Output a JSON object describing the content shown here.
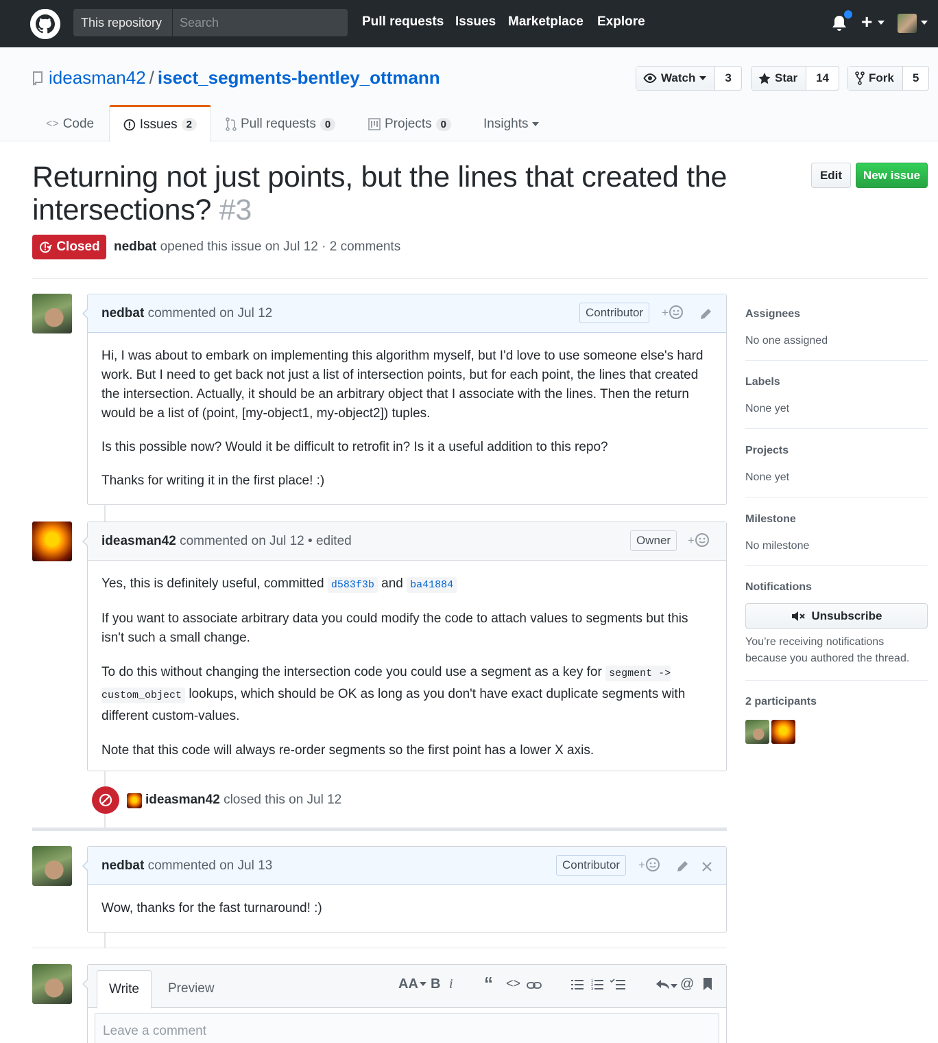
{
  "header": {
    "scope_label": "This repository",
    "search_placeholder": "Search",
    "nav": [
      "Pull requests",
      "Issues",
      "Marketplace",
      "Explore"
    ]
  },
  "repo": {
    "owner": "ideasman42",
    "name": "isect_segments-bentley_ottmann",
    "watch_label": "Watch",
    "watch_count": "3",
    "star_label": "Star",
    "star_count": "14",
    "fork_label": "Fork",
    "fork_count": "5",
    "tabs": [
      {
        "label": "Code",
        "count": ""
      },
      {
        "label": "Issues",
        "count": "2"
      },
      {
        "label": "Pull requests",
        "count": "0"
      },
      {
        "label": "Projects",
        "count": "0"
      },
      {
        "label": "Insights",
        "count": ""
      }
    ]
  },
  "issue": {
    "title": "Returning not just points, but the lines that created the intersections?",
    "number": "#3",
    "edit_label": "Edit",
    "new_issue_label": "New issue",
    "state": "Closed",
    "author": "nedbat",
    "meta_text": "opened this issue on Jul 12 · 2 comments"
  },
  "comments": [
    {
      "author": "nedbat",
      "when": "commented on Jul 12",
      "badge": "Contributor",
      "paragraphs": [
        "Hi, I was about to embark on implementing this algorithm myself, but I'd love to use someone else's hard work. But I need to get back not just a list of intersection points, but for each point, the lines that created the intersection. Actually, it should be an arbitrary object that I associate with the lines. Then the return would be a list of (point, [my-object1, my-object2]) tuples.",
        "Is this possible now? Would it be difficult to retrofit in? Is it a useful addition to this repo?",
        "Thanks for writing it in the first place! :)"
      ]
    },
    {
      "author": "ideasman42",
      "when": "commented on Jul 12 • edited",
      "badge": "Owner",
      "p1_before": "Yes, this is definitely useful, committed",
      "sha1": "d583f3b",
      "p1_and": "and",
      "sha2": "ba41884",
      "p2": "If you want to associate arbitrary data you could modify the code to attach values to segments but this isn't such a small change.",
      "p3_before": "To do this without changing the intersection code you could use a segment as a key for",
      "p3_code": "segment -> custom_object",
      "p3_after": "lookups, which should be OK as long as you don't have exact duplicate segments with different custom-values.",
      "p4": "Note that this code will always re-order segments so the first point has a lower X axis."
    },
    {
      "author": "nedbat",
      "when": "commented on Jul 13",
      "badge": "Contributor",
      "body": "Wow, thanks for the fast turnaround! :)"
    }
  ],
  "event": {
    "actor": "ideasman42",
    "text": "closed this on Jul 12"
  },
  "compose": {
    "write_tab": "Write",
    "preview_tab": "Preview",
    "placeholder": "Leave a comment"
  },
  "sidebar": {
    "assignees_title": "Assignees",
    "assignees_value": "No one assigned",
    "labels_title": "Labels",
    "labels_value": "None yet",
    "projects_title": "Projects",
    "projects_value": "None yet",
    "milestone_title": "Milestone",
    "milestone_value": "No milestone",
    "notifications_title": "Notifications",
    "unsubscribe_label": "Unsubscribe",
    "notice": "You’re receiving notifications because you authored the thread.",
    "participants_title": "2 participants"
  },
  "colors": {
    "closed": "#cb2431",
    "new_issue": "#28a745",
    "link": "#0366d6",
    "header_bg": "#24292e"
  }
}
